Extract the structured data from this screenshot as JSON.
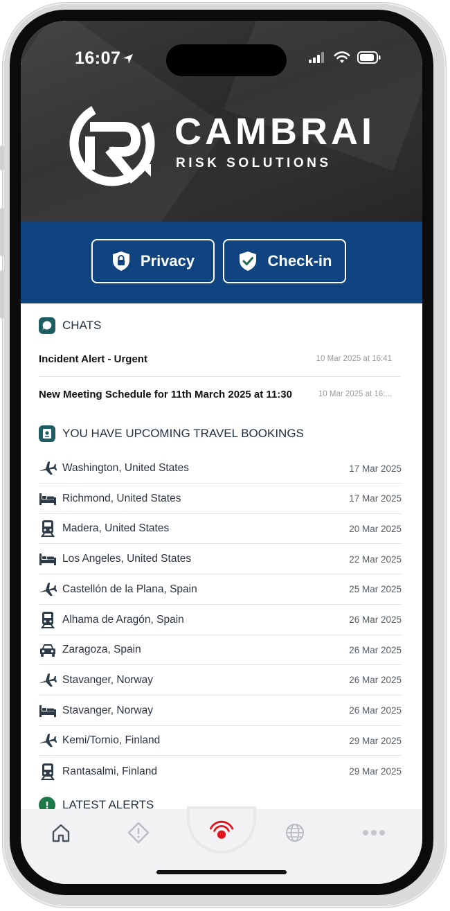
{
  "status_bar": {
    "time": "16:07"
  },
  "brand": {
    "name": "CAMBRAI",
    "subtitle": "RISK SOLUTIONS"
  },
  "actions": {
    "privacy_label": "Privacy",
    "checkin_label": "Check-in"
  },
  "chats": {
    "heading": "CHATS",
    "items": [
      {
        "title": "Incident Alert - Urgent",
        "time": "10 Mar 2025 at 16:41"
      },
      {
        "title": "New Meeting Schedule for 11th March 2025 at 11:30",
        "time": "10 Mar 2025 at 16:..."
      }
    ]
  },
  "bookings": {
    "heading": "YOU HAVE UPCOMING TRAVEL BOOKINGS",
    "items": [
      {
        "icon": "plane-icon",
        "destination": "Washington, United States",
        "date": "17 Mar 2025"
      },
      {
        "icon": "bed-icon",
        "destination": "Richmond, United States",
        "date": "17 Mar 2025"
      },
      {
        "icon": "train-icon",
        "destination": "Madera, United States",
        "date": "20 Mar 2025"
      },
      {
        "icon": "bed-icon",
        "destination": "Los Angeles, United States",
        "date": "22 Mar 2025"
      },
      {
        "icon": "plane-icon",
        "destination": "Castellón de la Plana, Spain",
        "date": "25 Mar 2025"
      },
      {
        "icon": "train-icon",
        "destination": "Alhama de Aragón, Spain",
        "date": "26 Mar 2025"
      },
      {
        "icon": "car-icon",
        "destination": "Zaragoza, Spain",
        "date": "26 Mar 2025"
      },
      {
        "icon": "plane-icon",
        "destination": "Stavanger, Norway",
        "date": "26 Mar 2025"
      },
      {
        "icon": "bed-icon",
        "destination": "Stavanger, Norway",
        "date": "26 Mar 2025"
      },
      {
        "icon": "plane-icon",
        "destination": "Kemi/Tornio, Finland",
        "date": "29 Mar 2025"
      },
      {
        "icon": "train-icon",
        "destination": "Rantasalmi, Finland",
        "date": "29 Mar 2025"
      }
    ]
  },
  "alerts": {
    "heading": "LATEST ALERTS"
  },
  "tabbar": {
    "tabs": [
      {
        "icon": "home-icon"
      },
      {
        "icon": "alert-diamond-icon"
      },
      {
        "icon": "sos-broadcast-icon"
      },
      {
        "icon": "globe-icon"
      },
      {
        "icon": "more-icon"
      }
    ]
  },
  "colors": {
    "header_dark": "#2e2e30",
    "brand_blue": "#0f4480",
    "section_icon": "#1e5e63",
    "sos_red": "#e0141e",
    "icon_dark": "#2d3a48"
  }
}
